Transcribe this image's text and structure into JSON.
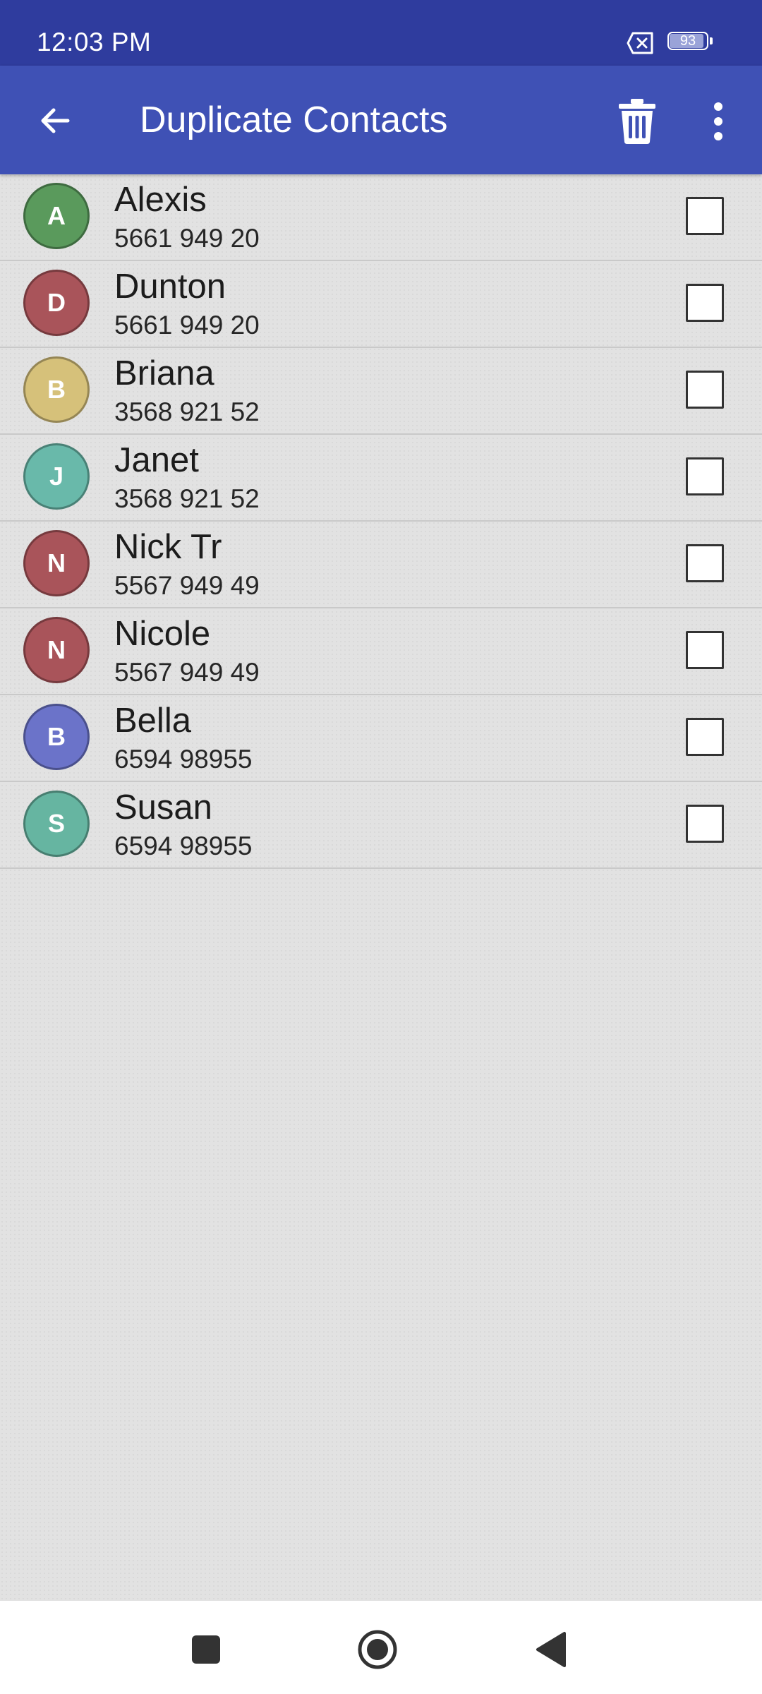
{
  "status_bar": {
    "time": "12:03 PM",
    "battery_level": "93",
    "battery_fraction": 0.93,
    "icons": [
      "x-box-icon",
      "battery-icon"
    ]
  },
  "app_bar": {
    "title": "Duplicate Contacts",
    "icons": [
      "back-arrow-icon",
      "trash-icon",
      "more-vert-icon"
    ]
  },
  "contacts": [
    {
      "initial": "A",
      "name": "Alexis",
      "phone": "5661 949 20",
      "color": "#5a9a5c",
      "checked": false
    },
    {
      "initial": "D",
      "name": "Dunton",
      "phone": "5661 949 20",
      "color": "#a9545a",
      "checked": false
    },
    {
      "initial": "B",
      "name": "Briana",
      "phone": "3568 921 52",
      "color": "#d6c17a",
      "checked": false
    },
    {
      "initial": "J",
      "name": "Janet",
      "phone": "3568 921 52",
      "color": "#69b9aa",
      "checked": false
    },
    {
      "initial": "N",
      "name": "Nick Tr",
      "phone": "5567 949 49",
      "color": "#a9545a",
      "checked": false
    },
    {
      "initial": "N",
      "name": "Nicole",
      "phone": "5567 949 49",
      "color": "#a9545a",
      "checked": false
    },
    {
      "initial": "B",
      "name": "Bella",
      "phone": "6594 98955",
      "color": "#6b73c9",
      "checked": false
    },
    {
      "initial": "S",
      "name": "Susan",
      "phone": "6594 98955",
      "color": "#66b5a1",
      "checked": false
    }
  ],
  "nav_bar": {
    "icons": [
      "recents-square-icon",
      "home-circle-icon",
      "back-triangle-icon"
    ]
  },
  "colors": {
    "status_bar": "#2f3c9e",
    "app_bar": "#3f51b5",
    "background": "#e2e2e2"
  }
}
